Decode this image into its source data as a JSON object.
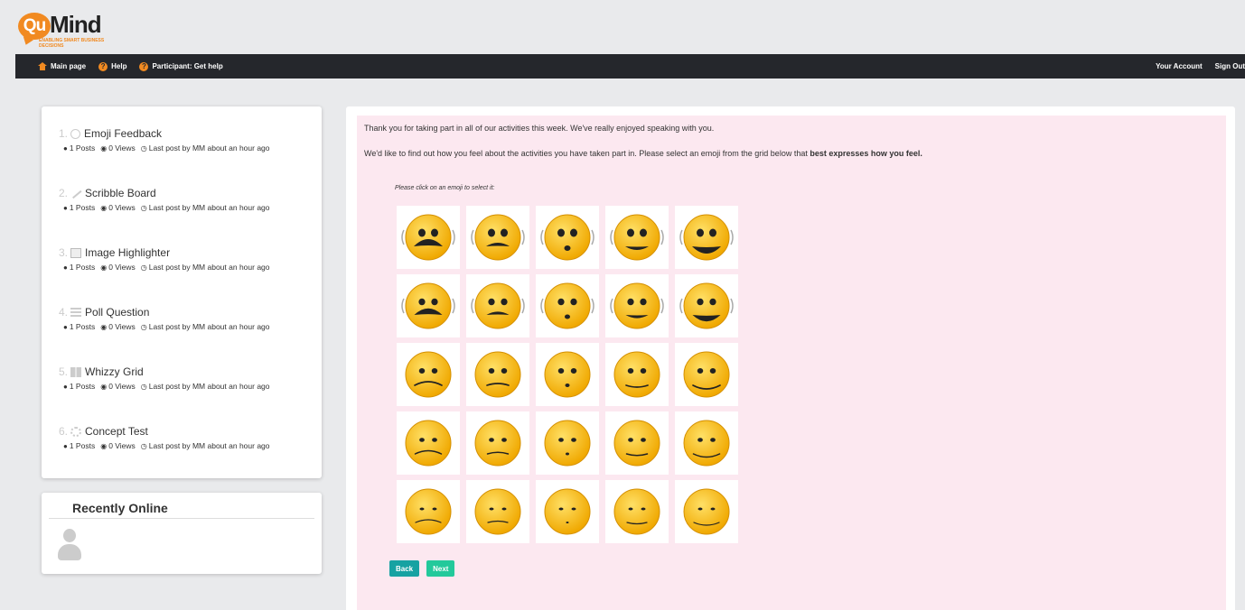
{
  "brand": {
    "logo_mark": "Qu",
    "logo_word": "Mind",
    "tagline": "ENABLING SMART BUSINESS DECISIONS",
    "accent": "#f18a21"
  },
  "nav": {
    "main_page": "Main page",
    "help": "Help",
    "participant_help": "Participant: Get help",
    "your_account": "Your Account",
    "sign_out": "Sign Out"
  },
  "activities": [
    {
      "num": "1.",
      "icon": "emoji-icon",
      "title": "Emoji Feedback",
      "posts": "1 Posts",
      "views": "0 Views",
      "last_post": "Last post by MM about an hour ago"
    },
    {
      "num": "2.",
      "icon": "brush-icon",
      "title": "Scribble Board",
      "posts": "1 Posts",
      "views": "0 Views",
      "last_post": "Last post by MM about an hour ago"
    },
    {
      "num": "3.",
      "icon": "image-icon",
      "title": "Image Highlighter",
      "posts": "1 Posts",
      "views": "0 Views",
      "last_post": "Last post by MM about an hour ago"
    },
    {
      "num": "4.",
      "icon": "list-icon",
      "title": "Poll Question",
      "posts": "1 Posts",
      "views": "0 Views",
      "last_post": "Last post by MM about an hour ago"
    },
    {
      "num": "5.",
      "icon": "grid-icon",
      "title": "Whizzy Grid",
      "posts": "1 Posts",
      "views": "0 Views",
      "last_post": "Last post by MM about an hour ago"
    },
    {
      "num": "6.",
      "icon": "spinner-icon",
      "title": "Concept Test",
      "posts": "1 Posts",
      "views": "0 Views",
      "last_post": "Last post by MM about an hour ago"
    }
  ],
  "online": {
    "title": "Recently Online"
  },
  "main": {
    "intro1": "Thank you for taking part in all of our activities this week. We've really enjoyed speaking with you.",
    "intro2_prefix": "We'd like to find out how you feel about the activities you have taken part in. Please select an emoji from the grid below that ",
    "intro2_bold": "best expresses how you feel.",
    "instruction": "Please click on an emoji to select it:",
    "back_label": "Back",
    "next_label": "Next",
    "panel_bg": "#fce8f0"
  },
  "emoji_grid": {
    "rows": 5,
    "cols": 5,
    "description_note": "rows vary in arousal (top high, bottom low); columns vary in valence (left negative, right positive)"
  }
}
